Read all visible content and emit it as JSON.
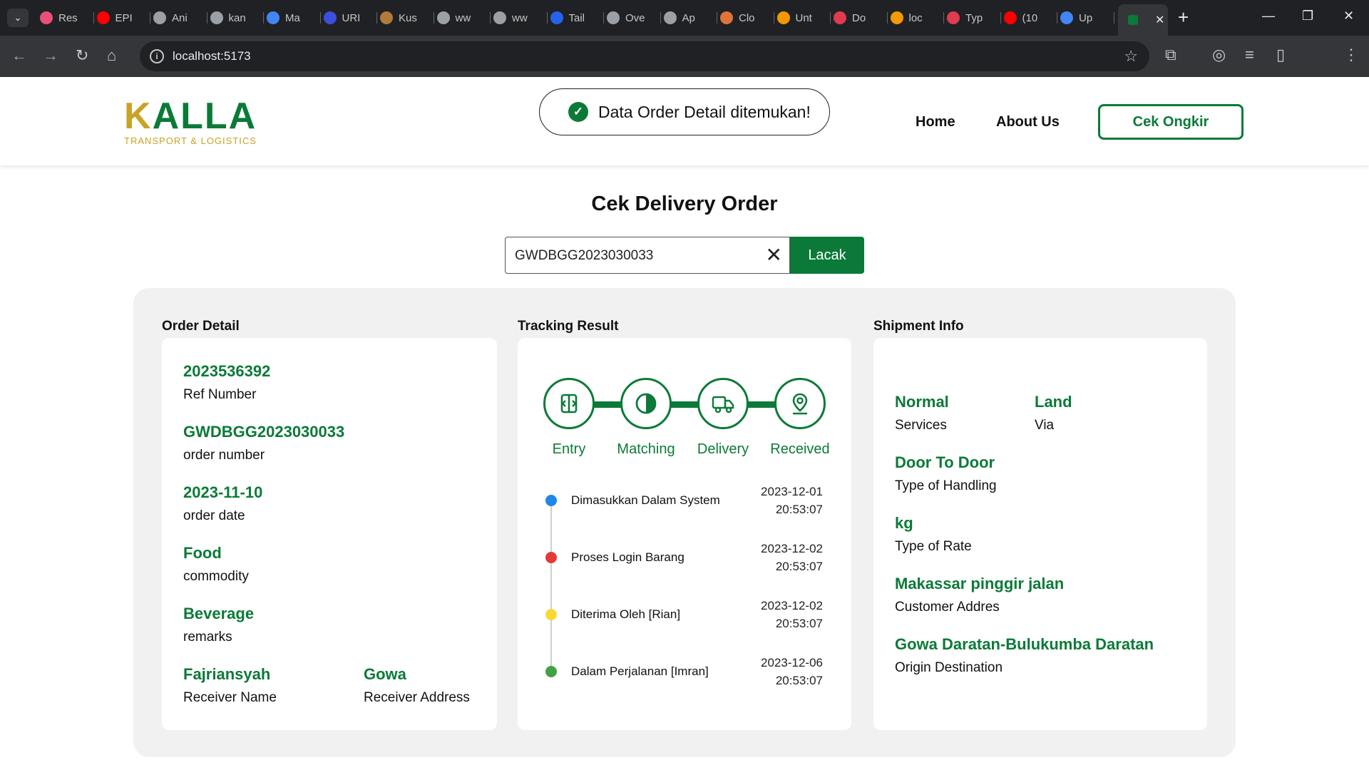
{
  "browser": {
    "tabs": [
      {
        "label": "Res",
        "color": "#e8507a"
      },
      {
        "label": "EPI",
        "color": "#ff0000"
      },
      {
        "label": "Ani",
        "color": "#9aa0a6"
      },
      {
        "label": "kan",
        "color": "#9aa0a6"
      },
      {
        "label": "Ma",
        "color": "#4285f4"
      },
      {
        "label": "URI",
        "color": "#3c4fe0"
      },
      {
        "label": "Kus",
        "color": "#b07a3a"
      },
      {
        "label": "ww",
        "color": "#9aa0a6"
      },
      {
        "label": "ww",
        "color": "#9aa0a6"
      },
      {
        "label": "Tail",
        "color": "#2563eb"
      },
      {
        "label": "Ove",
        "color": "#9aa0a6"
      },
      {
        "label": "Ap",
        "color": "#9aa0a6"
      },
      {
        "label": "Clo",
        "color": "#e0733a"
      },
      {
        "label": "Unt",
        "color": "#f29900"
      },
      {
        "label": "Do",
        "color": "#e23a4f"
      },
      {
        "label": "loc",
        "color": "#f29900"
      },
      {
        "label": "Typ",
        "color": "#e23a4f"
      },
      {
        "label": "(10",
        "color": "#ff0000"
      },
      {
        "label": "Up",
        "color": "#4285f4"
      }
    ],
    "active_tab_close": "✕",
    "new_tab": "+",
    "url": "localhost:5173"
  },
  "header": {
    "logo_main": "KALLA",
    "logo_sub": "TRANSPORT & LOGISTICS",
    "toast_message": "Data Order Detail ditemukan!",
    "nav": {
      "home": "Home",
      "about": "About Us",
      "cek_ongkir": "Cek Ongkir"
    }
  },
  "page": {
    "title": "Cek Delivery Order",
    "search_value": "GWDBGG2023030033",
    "search_button": "Lacak"
  },
  "order_detail": {
    "title": "Order Detail",
    "ref_number": {
      "value": "2023536392",
      "label": "Ref Number"
    },
    "order_number": {
      "value": "GWDBGG2023030033",
      "label": "order number"
    },
    "order_date": {
      "value": "2023-11-10",
      "label": "order date"
    },
    "commodity": {
      "value": "Food",
      "label": "commodity"
    },
    "remarks": {
      "value": "Beverage",
      "label": "remarks"
    },
    "receiver_name": {
      "value": "Fajriansyah",
      "label": "Receiver Name"
    },
    "receiver_address": {
      "value": "Gowa",
      "label": "Receiver Address"
    }
  },
  "tracking": {
    "title": "Tracking Result",
    "steps": [
      "Entry",
      "Matching",
      "Delivery",
      "Received"
    ],
    "events": [
      {
        "text": "Dimasukkan Dalam System",
        "date": "2023-12-01",
        "time": "20:53:07",
        "color": "#1e88e5"
      },
      {
        "text": "Proses Login Barang",
        "date": "2023-12-02",
        "time": "20:53:07",
        "color": "#e53935"
      },
      {
        "text": "Diterima Oleh [Rian]",
        "date": "2023-12-02",
        "time": "20:53:07",
        "color": "#fdd835"
      },
      {
        "text": "Dalam Perjalanan [Imran]",
        "date": "2023-12-06",
        "time": "20:53:07",
        "color": "#43a047"
      }
    ]
  },
  "shipment": {
    "title": "Shipment Info",
    "services": {
      "value": "Normal",
      "label": "Services"
    },
    "via": {
      "value": "Land",
      "label": "Via"
    },
    "handling": {
      "value": "Door To Door",
      "label": "Type of Handling"
    },
    "rate": {
      "value": "kg",
      "label": "Type of Rate"
    },
    "customer_address": {
      "value": "Makassar pinggir jalan",
      "label": "Customer Addres"
    },
    "origin_destination": {
      "value": "Gowa Daratan-Bulukumba Daratan",
      "label": "Origin Destination"
    }
  },
  "colors": {
    "brand_green": "#0b7a38",
    "brand_gold": "#c9a227"
  }
}
